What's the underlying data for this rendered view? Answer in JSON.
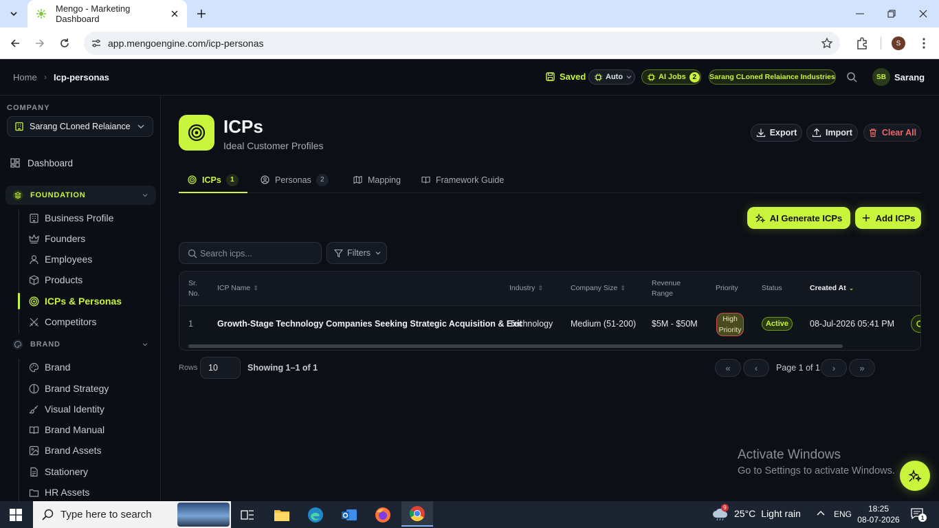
{
  "browser": {
    "tab_title": "Mengo - Marketing Dashboard",
    "url": "app.mengoengine.com/icp-personas",
    "profile_initial": "S"
  },
  "header": {
    "breadcrumb": [
      "Home",
      "Icp-personas"
    ],
    "saved": "Saved",
    "auto": "Auto",
    "ai_jobs_label": "AI Jobs",
    "ai_jobs_count": "2",
    "company_chip": "Sarang CLoned Relaiance Industries",
    "user_initials": "SB",
    "user_name": "Sarang"
  },
  "sidebar": {
    "company_label": "COMPANY",
    "company_selected": "Sarang CLoned Relaiance ...",
    "dashboard": "Dashboard",
    "foundation": {
      "title": "FOUNDATION",
      "items": [
        "Business Profile",
        "Founders",
        "Employees",
        "Products",
        "ICPs & Personas",
        "Competitors"
      ]
    },
    "brand": {
      "title": "BRAND",
      "items": [
        "Brand",
        "Brand Strategy",
        "Visual Identity",
        "Brand Manual",
        "Brand Assets",
        "Stationery",
        "HR Assets"
      ]
    }
  },
  "page": {
    "title": "ICPs",
    "subtitle": "Ideal Customer Profiles",
    "actions": {
      "export": "Export",
      "import": "Import",
      "clear": "Clear All"
    },
    "tabs": [
      {
        "label": "ICPs",
        "count": "1"
      },
      {
        "label": "Personas",
        "count": "2"
      },
      {
        "label": "Mapping"
      },
      {
        "label": "Framework Guide"
      }
    ],
    "ai_generate": "AI Generate ICPs",
    "add": "Add ICPs",
    "search_placeholder": "Search icps...",
    "filters": "Filters"
  },
  "table": {
    "headers": {
      "srno": [
        "Sr.",
        "No."
      ],
      "name": "ICP Name",
      "industry": "Industry",
      "size": "Company Size",
      "revenue": [
        "Revenue",
        "Range"
      ],
      "priority": "Priority",
      "status": "Status",
      "created": "Created At"
    },
    "rows": [
      {
        "srno": "1",
        "name": "Growth-Stage Technology Companies Seeking Strategic Acquisition & Exit",
        "industry": "Technology",
        "size": "Medium (51-200)",
        "revenue": "$5M - $50M",
        "priority": [
          "High",
          "Priority"
        ],
        "status": "Active",
        "created": "08-Jul-2026 05:41 PM"
      }
    ]
  },
  "pagination": {
    "rows_label": "Rows",
    "rows_value": "10",
    "showing": "Showing 1–1 of 1",
    "page_of": "Page 1 of 1",
    "first": "«",
    "prev": "‹",
    "next": "›",
    "last": "»"
  },
  "watermark": {
    "line1": "Activate Windows",
    "line2": "Go to Settings to activate Windows."
  },
  "taskbar": {
    "search": "Type here to search",
    "weather_temp": "25°C",
    "weather_desc": "Light rain",
    "weather_badge": "9",
    "lang": "ENG",
    "time": "18:25",
    "date": "08-07-2026",
    "notifications": "1"
  }
}
